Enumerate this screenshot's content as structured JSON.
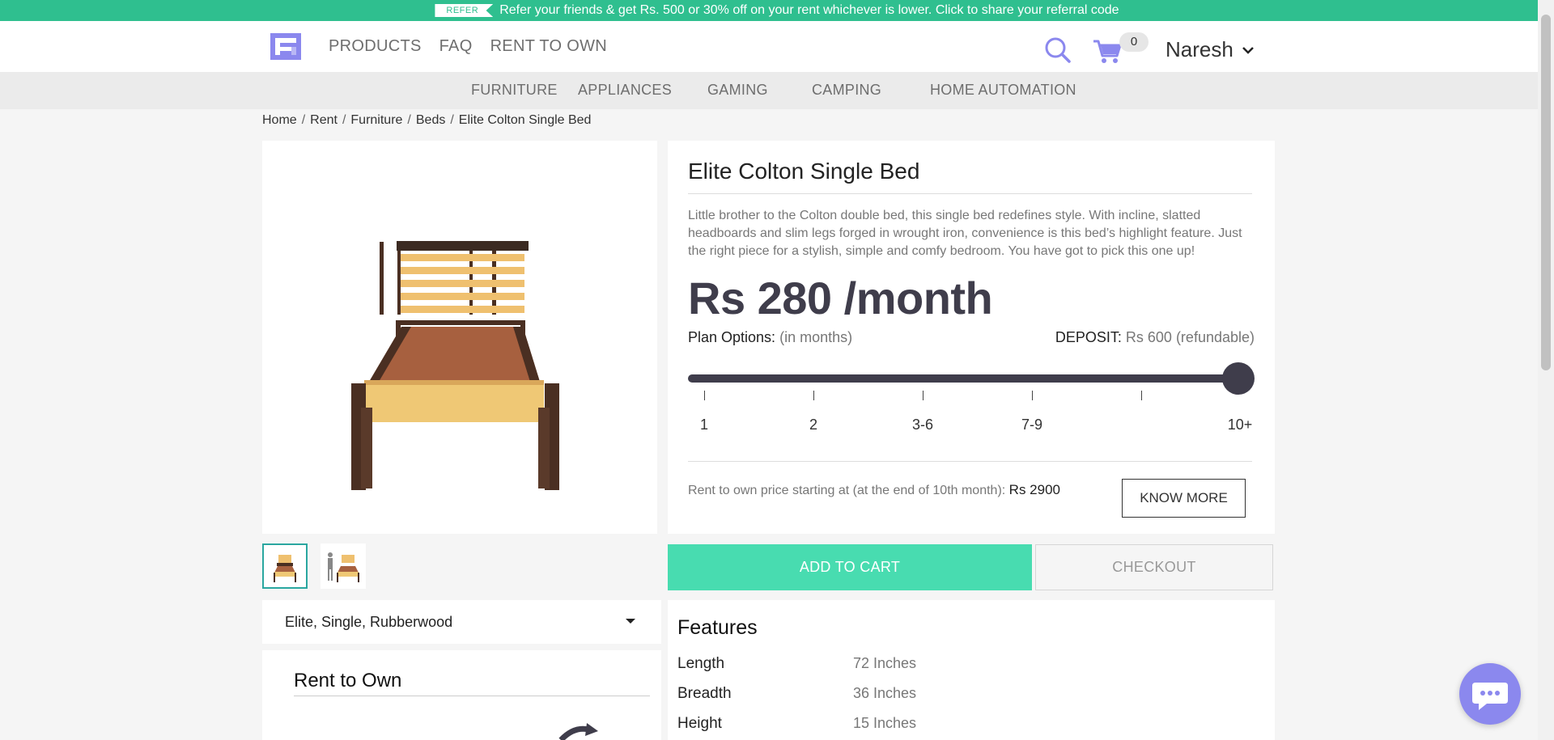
{
  "refer": {
    "tag": "REFER",
    "text": "Refer your friends & get Rs. 500 or 30% off on your rent whichever is lower. Click to share your referral code"
  },
  "header": {
    "nav": [
      "PRODUCTS",
      "FAQ",
      "RENT TO OWN"
    ],
    "cart_count": "0",
    "user_name": "Naresh"
  },
  "categories": [
    "FURNITURE",
    "APPLIANCES",
    "GAMING",
    "CAMPING",
    "HOME AUTOMATION"
  ],
  "breadcrumb": [
    "Home",
    "Rent",
    "Furniture",
    "Beds",
    "Elite Colton Single Bed"
  ],
  "product": {
    "title": "Elite Colton Single Bed",
    "description": "Little brother to the Colton double bed, this single bed redefines style. With incline, slatted headboards and slim legs forged in wrought iron, convenience is this bed’s highlight feature. Just the right piece for a stylish, simple and comfy bedroom. You have got to pick this one up!",
    "price": "Rs 280 /month",
    "plan_label": "Plan Options:",
    "plan_unit": "(in months)",
    "deposit_label": "DEPOSIT:",
    "deposit_value": "Rs 600 (refundable)",
    "plan_ticks": [
      "1",
      "2",
      "3-6",
      "7-9",
      "10+"
    ],
    "selected_plan": "10+",
    "rto_text": "Rent to own price starting at (at the end of 10th month):",
    "rto_price": "Rs 2900",
    "know_more": "KNOW MORE",
    "variant": "Elite, Single, Rubberwood"
  },
  "actions": {
    "add_to_cart": "ADD TO CART",
    "checkout": "CHECKOUT"
  },
  "rent_to_own_card": {
    "title": "Rent to Own"
  },
  "features": {
    "title": "Features",
    "rows": [
      {
        "label": "Length",
        "value": "72 Inches"
      },
      {
        "label": "Breadth",
        "value": "36 Inches"
      },
      {
        "label": "Height",
        "value": "15 Inches"
      }
    ]
  },
  "colors": {
    "brand": "#2fbf8f",
    "add_to_cart": "#48dcb0",
    "slider": "#3f3d4b",
    "icon_accent": "#8b88ee"
  }
}
